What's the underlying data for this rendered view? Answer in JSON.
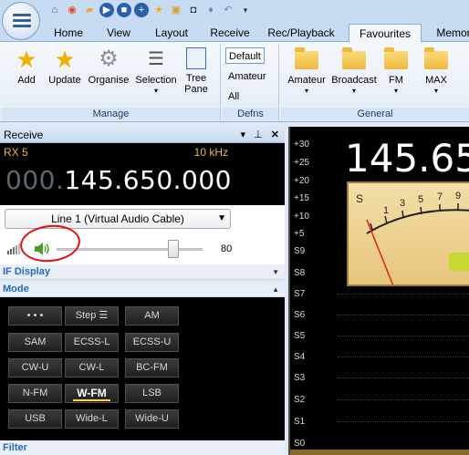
{
  "quick_access": [
    "home-icon",
    "lifebuoy-icon",
    "folder-icon",
    "play-icon",
    "stop-icon",
    "plus-icon",
    "star-icon",
    "lock-icon",
    "camera-icon",
    "drop-icon",
    "undo-icon",
    "dropdown-icon"
  ],
  "tabs": [
    "Home",
    "View",
    "Layout",
    "Receive",
    "Rec/Playback",
    "Favourites",
    "Memor"
  ],
  "active_tab": "Favourites",
  "ribbon": {
    "manage": {
      "label": "Manage",
      "add": "Add",
      "update": "Update",
      "organise": "Organise",
      "selection": "Selection",
      "tree": "Tree",
      "pane": "Pane"
    },
    "defns": {
      "label": "Defns",
      "default": "Default",
      "amateur": "Amateur",
      "all": "All"
    },
    "general": {
      "label": "General",
      "amateur": "Amateur",
      "broadcast": "Broadcast",
      "fm": "FM",
      "max": "MAX"
    }
  },
  "receive": {
    "title": "Receive",
    "rx": "RX 5",
    "step": "10 kHz",
    "freq_dim": "000.",
    "freq": "145.650.000",
    "audio_device": "Line 1 (Virtual Audio Cable)",
    "volume": "80",
    "volume_level": 0.8,
    "if_display": "IF Display",
    "mode": "Mode",
    "filter": "Filter",
    "mode_buttons": [
      [
        "• • •",
        "Step ☰",
        "AM"
      ],
      [
        "SAM",
        "ECSS-L",
        "ECSS-U"
      ],
      [
        "CW-U",
        "CW-L",
        "BC-FM"
      ],
      [
        "N-FM",
        "W-FM",
        "LSB"
      ],
      [
        "USB",
        "Wide-L",
        "Wide-U"
      ]
    ],
    "active_mode": "W-FM"
  },
  "spectrum": {
    "display_freq": "145.65",
    "scale": [
      "+30",
      "+25",
      "+20",
      "+15",
      "+10",
      "+5",
      "S9",
      "S8",
      "S7",
      "S6",
      "S5",
      "S4",
      "S3",
      "S2",
      "S1",
      "S0"
    ],
    "meter_ticks": [
      "S",
      "1",
      "3",
      "5",
      "7",
      "9"
    ]
  },
  "colors": {
    "accent": "#e5b94b",
    "annotation": "#e01010",
    "link": "#2a6ab8"
  }
}
